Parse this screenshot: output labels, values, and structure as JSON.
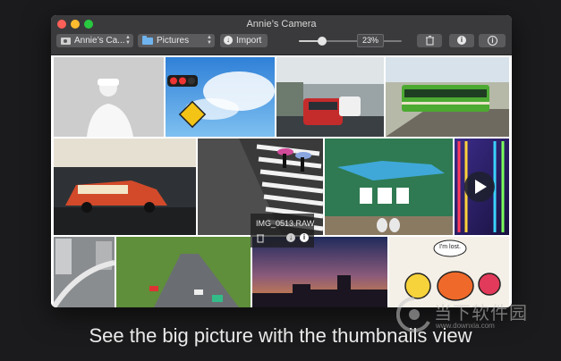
{
  "window": {
    "title": "Annie’s Camera"
  },
  "toolbar": {
    "source_label": "Annie’s Ca...",
    "folder_label": "Pictures",
    "import_label": "Import",
    "zoom_value": "23%",
    "zoom_level": 0.23
  },
  "selected_photo": {
    "filename": "IMG_0513.RAW"
  },
  "caption": "See the big picture with the thumbnails view",
  "watermark": {
    "text": "当下软件园",
    "url": "www.downxia.com"
  },
  "photos": [
    {
      "name": "photo-man-white-hat",
      "kind": "bw"
    },
    {
      "name": "photo-traffic-light-sky",
      "kind": "sky"
    },
    {
      "name": "photo-street-cars",
      "kind": "street"
    },
    {
      "name": "photo-green-train",
      "kind": "train"
    },
    {
      "name": "photo-taxi",
      "kind": "taxi"
    },
    {
      "name": "photo-crosswalk",
      "kind": "crosswalk"
    },
    {
      "name": "photo-tomare-crocodile",
      "kind": "croc"
    },
    {
      "name": "photo-neon-lights",
      "kind": "neon"
    },
    {
      "name": "photo-highway-bw",
      "kind": "highway"
    },
    {
      "name": "photo-tree-road",
      "kind": "treeroad"
    },
    {
      "name": "photo-sunset-city",
      "kind": "sunset"
    },
    {
      "name": "photo-cartoon-lost",
      "kind": "cartoon",
      "speech": "I'm lost."
    }
  ],
  "colors": {
    "window_bg": "#3a3a3c",
    "control_bg": "#5b5b5e",
    "page_bg": "#1b1b1d"
  }
}
